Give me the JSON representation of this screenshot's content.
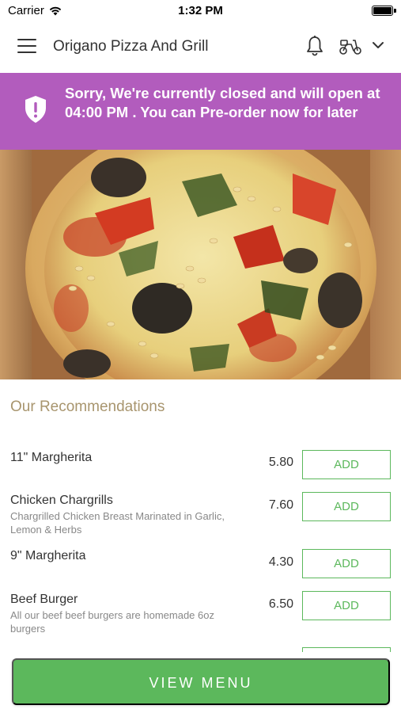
{
  "status_bar": {
    "carrier": "Carrier",
    "time": "1:32 PM",
    "wifi_icon": "wifi-icon",
    "battery_icon": "battery-icon"
  },
  "nav": {
    "title": "Origano Pizza And Grill",
    "menu_icon": "hamburger-menu-icon",
    "bell_icon": "bell-icon",
    "scooter_icon": "scooter-icon",
    "chevron_icon": "chevron-down-icon"
  },
  "banner": {
    "text": "Sorry, We're currently closed and will open at 04:00 PM . You can Pre-order now for later",
    "icon": "shield-alert-icon",
    "color": "#b25cbd"
  },
  "hero": {
    "image": "pizza-photo"
  },
  "recommendations": {
    "title": "Our Recommendations",
    "items": [
      {
        "name": "11\" Margherita",
        "description": "",
        "price": "5.80",
        "add_label": "ADD"
      },
      {
        "name": "Chicken Chargrills",
        "description": "Chargrilled Chicken Breast Marinated in Garlic, Lemon & Herbs",
        "price": "7.60",
        "add_label": "ADD"
      },
      {
        "name": "9\" Margherita",
        "description": "",
        "price": "4.30",
        "add_label": "ADD"
      },
      {
        "name": "Beef Burger",
        "description": "All our beef beef burgers are homemade 6oz burgers",
        "price": "6.50",
        "add_label": "ADD"
      }
    ]
  },
  "footer": {
    "view_menu_label": "VIEW MENU"
  },
  "colors": {
    "accent_green": "#5cb85c",
    "banner_purple": "#b25cbd",
    "section_title": "#a8956e"
  }
}
